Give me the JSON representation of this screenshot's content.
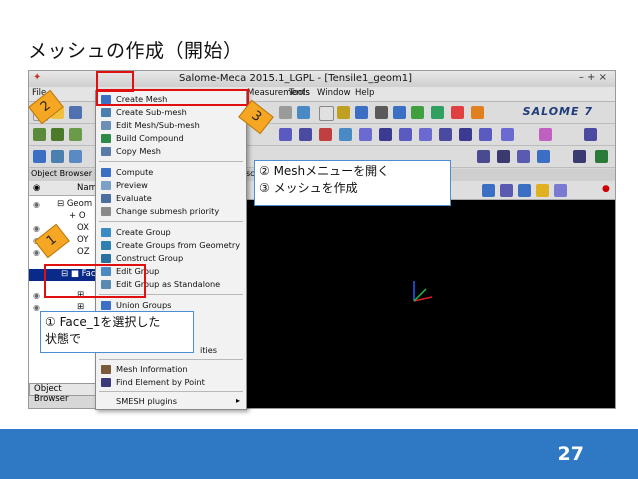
{
  "slide": {
    "title": "メッシュの作成（開始）",
    "page_number": "27"
  },
  "window": {
    "title": "Salome-Meca 2015.1_LGPL - [Tensile1_geom1]",
    "controls": "– + ×",
    "logo_text": "SALOME 7"
  },
  "menubar": {
    "items": [
      "File",
      "Measurements",
      "Tools",
      "Window",
      "Help"
    ]
  },
  "object_browser": {
    "header": "Object Browser",
    "col_name": "Name",
    "tab": "Object Browser",
    "items": [
      {
        "label": "Geom"
      },
      {
        "label": "O"
      },
      {
        "label": "OX"
      },
      {
        "label": "OY"
      },
      {
        "label": "OZ"
      },
      {
        "label": "Face_1"
      }
    ]
  },
  "mesh_menu": {
    "items": [
      {
        "label": "Create Mesh",
        "icon": "mesh-icon",
        "color": "#3a6fc4"
      },
      {
        "label": "Create Sub-mesh",
        "icon": "submesh-icon",
        "color": "#4a7fb0"
      },
      {
        "label": "Edit Mesh/Sub-mesh",
        "icon": "edit-mesh-icon",
        "color": "#6c8fb8"
      },
      {
        "label": "Build Compound",
        "icon": "compound-icon",
        "color": "#2f8a4a"
      },
      {
        "label": "Copy Mesh",
        "icon": "copy-mesh-icon",
        "color": "#5a7aa8"
      },
      {
        "label": "Compute",
        "icon": "compute-icon",
        "color": "#3a6fc4"
      },
      {
        "label": "Preview",
        "icon": "preview-icon",
        "color": "#7aa0c8"
      },
      {
        "label": "Evaluate",
        "icon": "evaluate-icon",
        "color": "#4a6fa0"
      },
      {
        "label": "Change submesh priority",
        "icon": "priority-icon",
        "color": "#8a8a8a"
      },
      {
        "label": "Create Group",
        "icon": "group-icon",
        "color": "#3a8ac4"
      },
      {
        "label": "Create Groups from Geometry",
        "icon": "groups-geom-icon",
        "color": "#2f7fb0"
      },
      {
        "label": "Construct Group",
        "icon": "construct-group-icon",
        "color": "#2a6fa0"
      },
      {
        "label": "Edit Group",
        "icon": "edit-group-icon",
        "color": "#4a8ac4"
      },
      {
        "label": "Edit Group as Standalone",
        "icon": "edit-standalone-icon",
        "color": "#5a8ab0"
      },
      {
        "label": "Union Groups",
        "icon": "union-icon",
        "color": "#3a6fc4"
      },
      {
        "label": "Mesh Information",
        "icon": "info-icon",
        "color": "#7a5a3a"
      },
      {
        "label": "Find Element by Point",
        "icon": "find-icon",
        "color": "#3a3a7a"
      },
      {
        "label": "SMESH plugins",
        "icon": "",
        "color": "#f2f2f2"
      }
    ],
    "partial_label": "ities",
    "submenu_arrow": "▸"
  },
  "callouts": {
    "mesh_steps": [
      "② Meshメニューを開く",
      "③ メッシュを作成"
    ],
    "select_face": [
      "① Face_1を選択した",
      "状態で"
    ]
  },
  "step_tags": {
    "one": "1",
    "two": "2",
    "three": "3"
  },
  "viewer": {
    "tab_label": "sc"
  },
  "colors": {
    "footer": "#2f78c4",
    "highlight": "#e01010",
    "tag": "#f5a623",
    "selection": "#0a2a8a"
  }
}
